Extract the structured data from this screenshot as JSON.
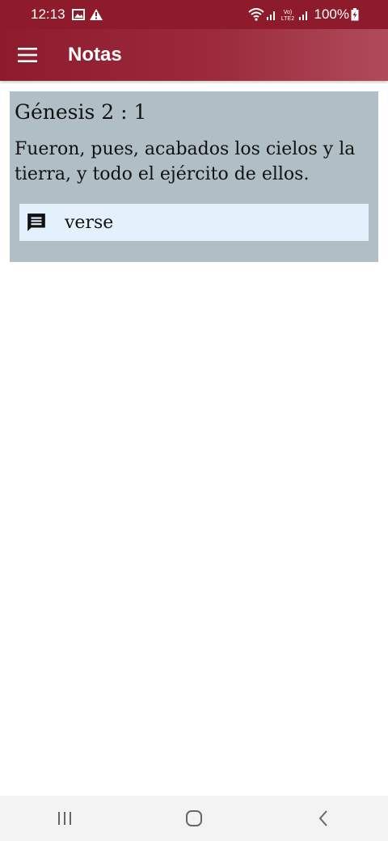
{
  "status_bar": {
    "time": "12:13",
    "battery": "100%",
    "network_label": "Vo) LTE2",
    "icons": [
      "image-icon",
      "alert-icon",
      "wifi-icon",
      "signal-icon",
      "lte-icon",
      "battery-charging-icon"
    ]
  },
  "app_bar": {
    "title": "Notas",
    "menu_icon": "hamburger-menu-icon",
    "color": "#8d1c2d"
  },
  "note": {
    "reference": "Génesis 2 : 1",
    "text": "Fueron, pues, acabados los cielos y la tierra, y todo el ejército de ellos.",
    "note_type": "verse",
    "note_icon": "comment-icon",
    "card_color": "#b0bec5",
    "chip_color": "#e4f1fd"
  },
  "nav_bar": {
    "buttons": [
      "recent-apps",
      "home",
      "back"
    ]
  }
}
